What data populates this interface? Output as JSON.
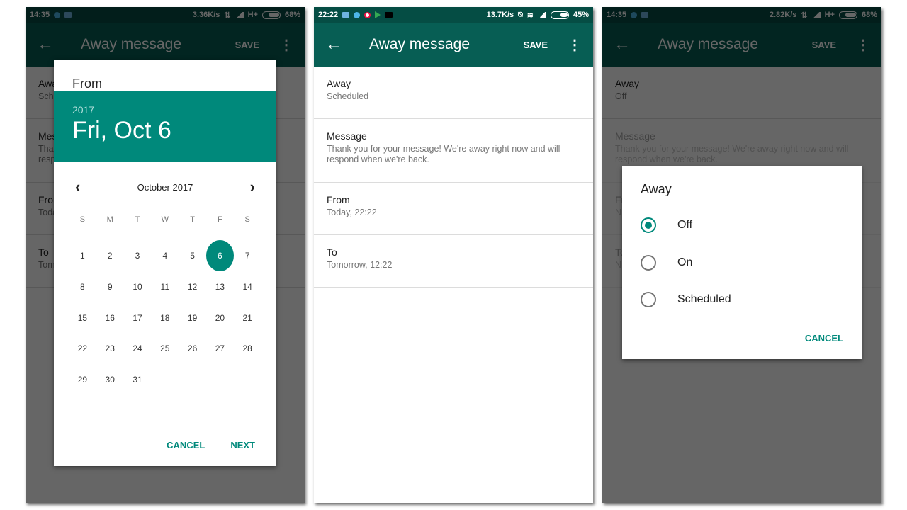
{
  "accent_color": "#00897b",
  "appbar_color": "#075e54",
  "screens": [
    {
      "status": {
        "time": "14:35",
        "speed": "3.36K/s",
        "network": "H+",
        "battery": "68%"
      },
      "appbar": {
        "title": "Away message",
        "save": "SAVE"
      },
      "rows": [
        {
          "label": "Away",
          "sub": "Scheduled"
        },
        {
          "label": "Message",
          "sub": "Thank you for your message! We're away right now and will respond when we're back."
        },
        {
          "label": "From",
          "sub": "Today, 22:22"
        },
        {
          "label": "To",
          "sub": "Tomorrow, 12:22"
        }
      ],
      "date_dialog": {
        "title": "From",
        "year": "2017",
        "selected_date": "Fri, Oct 6",
        "month_label": "October 2017",
        "weekdays": [
          "S",
          "M",
          "T",
          "W",
          "T",
          "F",
          "S"
        ],
        "first_weekday_offset": 0,
        "days_in_month": 31,
        "selected_day": 6,
        "cancel": "CANCEL",
        "next": "NEXT"
      }
    },
    {
      "status": {
        "time": "22:22",
        "speed": "13.7K/s",
        "battery": "45%"
      },
      "appbar": {
        "title": "Away message",
        "save": "SAVE"
      },
      "rows": [
        {
          "label": "Away",
          "sub": "Scheduled"
        },
        {
          "label": "Message",
          "sub": "Thank you for your message! We're away right now and will respond when we're back."
        },
        {
          "label": "From",
          "sub": "Today, 22:22"
        },
        {
          "label": "To",
          "sub": "Tomorrow, 12:22"
        }
      ]
    },
    {
      "status": {
        "time": "14:35",
        "speed": "2.82K/s",
        "network": "H+",
        "battery": "68%"
      },
      "appbar": {
        "title": "Away message",
        "save": "SAVE"
      },
      "rows": [
        {
          "label": "Away",
          "sub": "Off"
        },
        {
          "label": "Message",
          "sub": "Thank you for your message! We're away right now and will respond when we're back."
        },
        {
          "label": "From",
          "sub": "N"
        },
        {
          "label": "To",
          "sub": "N"
        }
      ],
      "away_dialog": {
        "title": "Away",
        "options": [
          "Off",
          "On",
          "Scheduled"
        ],
        "selected": "Off",
        "cancel": "CANCEL"
      }
    }
  ]
}
